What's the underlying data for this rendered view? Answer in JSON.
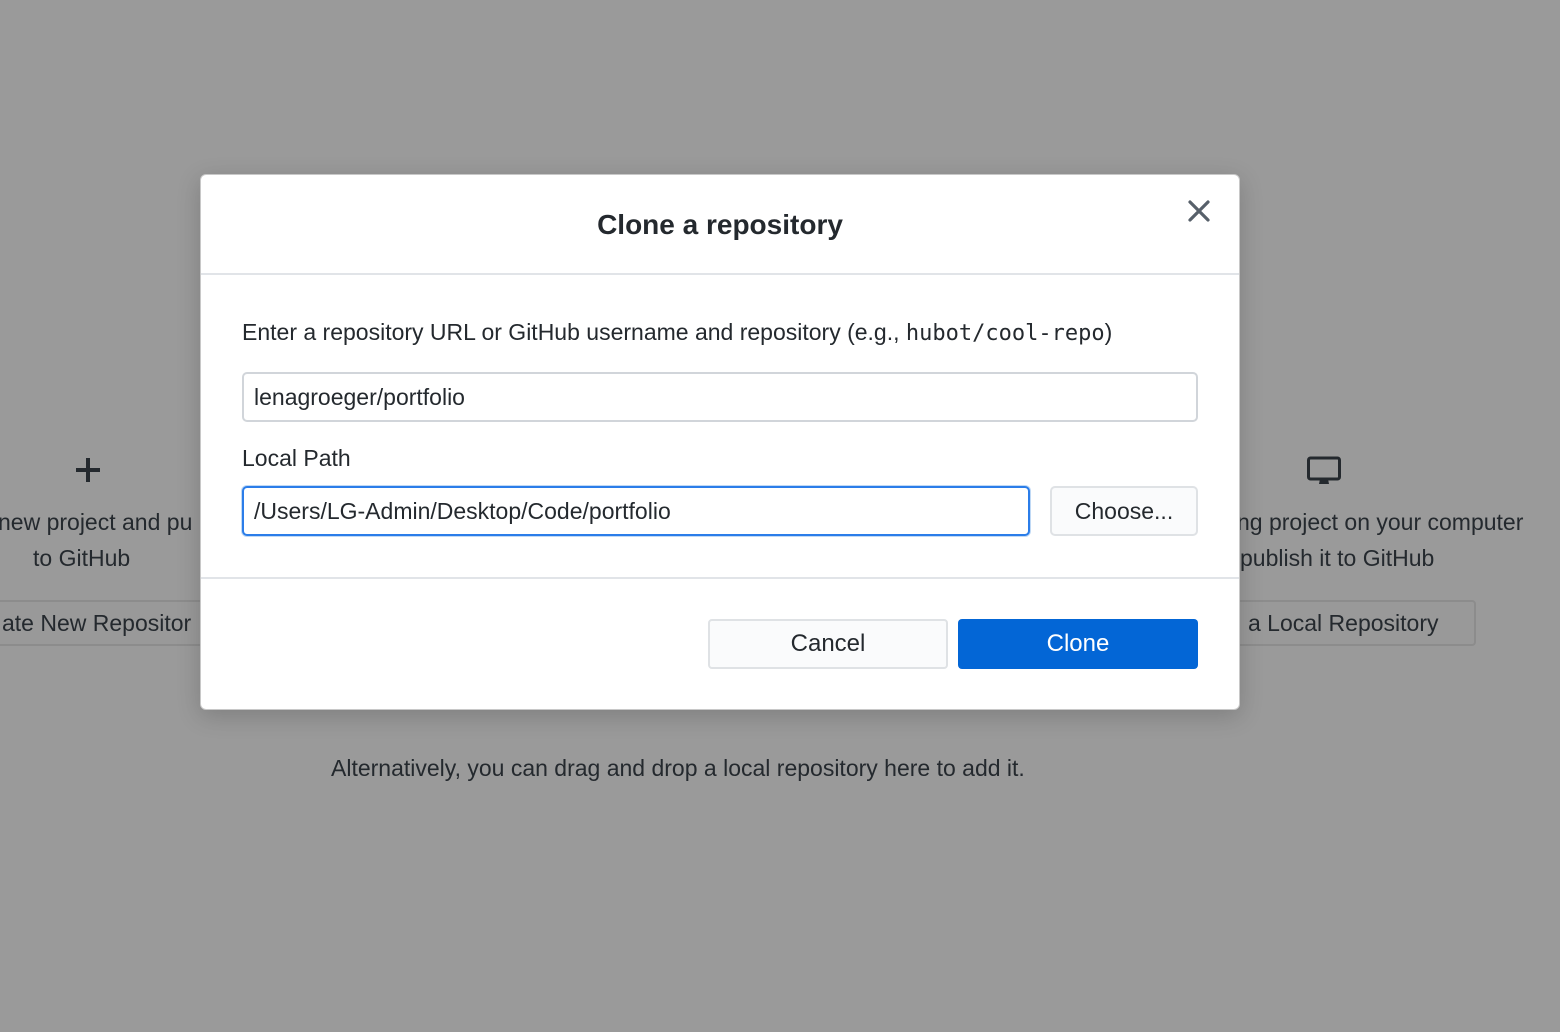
{
  "background": {
    "create": {
      "icon": "plus-icon",
      "line1": "new project and pu",
      "line2": "to GitHub",
      "button_label": "ate New Repositor"
    },
    "add_local": {
      "icon": "desktop-computer-icon",
      "line1": "ng project on your computer",
      "line2": "publish it to GitHub",
      "button_label": "a Local Repository"
    },
    "drag_drop_hint": "Alternatively, you can drag and drop a local repository here to add it."
  },
  "dialog": {
    "title": "Clone a repository",
    "close_icon": "close-icon",
    "url_label_prefix": "Enter a repository URL or GitHub username and repository (e.g., ",
    "url_label_example": "hubot/cool-repo",
    "url_label_suffix": ")",
    "url_value": "lenagroeger/portfolio",
    "local_path_label": "Local Path",
    "local_path_value": "/Users/LG-Admin/Desktop/Code/portfolio",
    "choose_label": "Choose...",
    "cancel_label": "Cancel",
    "clone_label": "Clone"
  },
  "colors": {
    "overlay_background": "#9a9a9a",
    "primary_button": "#0366d6",
    "focus_border": "#2b7de9"
  }
}
